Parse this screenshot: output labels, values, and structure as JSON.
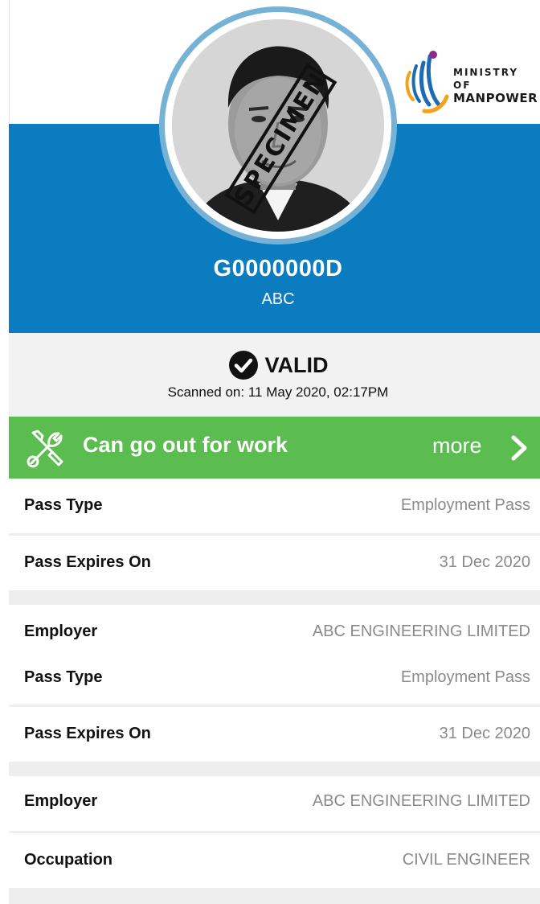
{
  "header": {
    "logo": {
      "line1": "MINISTRY OF",
      "line2": "MANPOWER"
    },
    "photo_watermark": "SPECIMEN",
    "pass_id": "G0000000D",
    "holder_name": "ABC"
  },
  "status": {
    "label": "VALID",
    "scanned": "Scanned on: 11 May 2020, 02:17PM"
  },
  "work_banner": {
    "text": "Can go out for work",
    "more": "more"
  },
  "rows": [
    {
      "label": "Pass Type",
      "value": "Employment Pass"
    },
    {
      "label": "Pass Expires On",
      "value": "31 Dec 2020"
    },
    {
      "label": "Employer",
      "value": "ABC ENGINEERING LIMITED"
    },
    {
      "label": "Pass Type",
      "value": "Employment Pass"
    },
    {
      "label": "Pass Expires On",
      "value": "31 Dec 2020"
    },
    {
      "label": "Employer",
      "value": "ABC ENGINEERING LIMITED"
    },
    {
      "label": "Occupation",
      "value": "CIVIL ENGINEER"
    }
  ],
  "colors": {
    "header_blue": "#0a7cbf",
    "ring_blue": "#75b2d6",
    "banner_green": "#5bbc50",
    "status_grey": "#f2f2f2"
  }
}
